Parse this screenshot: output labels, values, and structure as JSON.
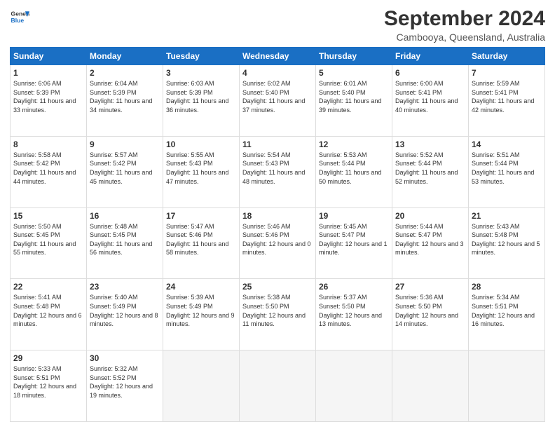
{
  "header": {
    "logo_line1": "General",
    "logo_line2": "Blue",
    "title": "September 2024",
    "subtitle": "Cambooya, Queensland, Australia"
  },
  "calendar": {
    "days_of_week": [
      "Sunday",
      "Monday",
      "Tuesday",
      "Wednesday",
      "Thursday",
      "Friday",
      "Saturday"
    ],
    "weeks": [
      [
        {
          "num": "",
          "empty": true
        },
        {
          "num": "2",
          "sunrise": "6:04 AM",
          "sunset": "5:39 PM",
          "daylight": "11 hours and 34 minutes."
        },
        {
          "num": "3",
          "sunrise": "6:03 AM",
          "sunset": "5:39 PM",
          "daylight": "11 hours and 36 minutes."
        },
        {
          "num": "4",
          "sunrise": "6:02 AM",
          "sunset": "5:40 PM",
          "daylight": "11 hours and 37 minutes."
        },
        {
          "num": "5",
          "sunrise": "6:01 AM",
          "sunset": "5:40 PM",
          "daylight": "11 hours and 39 minutes."
        },
        {
          "num": "6",
          "sunrise": "6:00 AM",
          "sunset": "5:41 PM",
          "daylight": "11 hours and 40 minutes."
        },
        {
          "num": "7",
          "sunrise": "5:59 AM",
          "sunset": "5:41 PM",
          "daylight": "11 hours and 42 minutes."
        }
      ],
      [
        {
          "num": "8",
          "sunrise": "5:58 AM",
          "sunset": "5:42 PM",
          "daylight": "11 hours and 44 minutes."
        },
        {
          "num": "9",
          "sunrise": "5:57 AM",
          "sunset": "5:42 PM",
          "daylight": "11 hours and 45 minutes."
        },
        {
          "num": "10",
          "sunrise": "5:55 AM",
          "sunset": "5:43 PM",
          "daylight": "11 hours and 47 minutes."
        },
        {
          "num": "11",
          "sunrise": "5:54 AM",
          "sunset": "5:43 PM",
          "daylight": "11 hours and 48 minutes."
        },
        {
          "num": "12",
          "sunrise": "5:53 AM",
          "sunset": "5:44 PM",
          "daylight": "11 hours and 50 minutes."
        },
        {
          "num": "13",
          "sunrise": "5:52 AM",
          "sunset": "5:44 PM",
          "daylight": "11 hours and 52 minutes."
        },
        {
          "num": "14",
          "sunrise": "5:51 AM",
          "sunset": "5:44 PM",
          "daylight": "11 hours and 53 minutes."
        }
      ],
      [
        {
          "num": "15",
          "sunrise": "5:50 AM",
          "sunset": "5:45 PM",
          "daylight": "11 hours and 55 minutes."
        },
        {
          "num": "16",
          "sunrise": "5:48 AM",
          "sunset": "5:45 PM",
          "daylight": "11 hours and 56 minutes."
        },
        {
          "num": "17",
          "sunrise": "5:47 AM",
          "sunset": "5:46 PM",
          "daylight": "11 hours and 58 minutes."
        },
        {
          "num": "18",
          "sunrise": "5:46 AM",
          "sunset": "5:46 PM",
          "daylight": "12 hours and 0 minutes."
        },
        {
          "num": "19",
          "sunrise": "5:45 AM",
          "sunset": "5:47 PM",
          "daylight": "12 hours and 1 minute."
        },
        {
          "num": "20",
          "sunrise": "5:44 AM",
          "sunset": "5:47 PM",
          "daylight": "12 hours and 3 minutes."
        },
        {
          "num": "21",
          "sunrise": "5:43 AM",
          "sunset": "5:48 PM",
          "daylight": "12 hours and 5 minutes."
        }
      ],
      [
        {
          "num": "22",
          "sunrise": "5:41 AM",
          "sunset": "5:48 PM",
          "daylight": "12 hours and 6 minutes."
        },
        {
          "num": "23",
          "sunrise": "5:40 AM",
          "sunset": "5:49 PM",
          "daylight": "12 hours and 8 minutes."
        },
        {
          "num": "24",
          "sunrise": "5:39 AM",
          "sunset": "5:49 PM",
          "daylight": "12 hours and 9 minutes."
        },
        {
          "num": "25",
          "sunrise": "5:38 AM",
          "sunset": "5:50 PM",
          "daylight": "12 hours and 11 minutes."
        },
        {
          "num": "26",
          "sunrise": "5:37 AM",
          "sunset": "5:50 PM",
          "daylight": "12 hours and 13 minutes."
        },
        {
          "num": "27",
          "sunrise": "5:36 AM",
          "sunset": "5:50 PM",
          "daylight": "12 hours and 14 minutes."
        },
        {
          "num": "28",
          "sunrise": "5:34 AM",
          "sunset": "5:51 PM",
          "daylight": "12 hours and 16 minutes."
        }
      ],
      [
        {
          "num": "29",
          "sunrise": "5:33 AM",
          "sunset": "5:51 PM",
          "daylight": "12 hours and 18 minutes."
        },
        {
          "num": "30",
          "sunrise": "5:32 AM",
          "sunset": "5:52 PM",
          "daylight": "12 hours and 19 minutes."
        },
        {
          "num": "",
          "empty": true
        },
        {
          "num": "",
          "empty": true
        },
        {
          "num": "",
          "empty": true
        },
        {
          "num": "",
          "empty": true
        },
        {
          "num": "",
          "empty": true
        }
      ]
    ],
    "week0_sunday": {
      "num": "1",
      "sunrise": "6:06 AM",
      "sunset": "5:39 PM",
      "daylight": "11 hours and 33 minutes."
    }
  }
}
